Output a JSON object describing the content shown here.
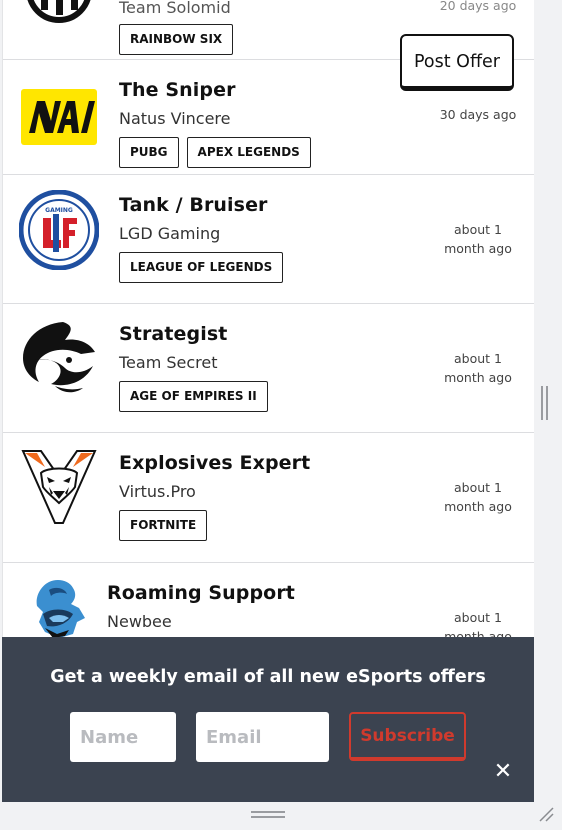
{
  "listings": [
    {
      "title": "",
      "team": "Team Solomid",
      "tags": [
        "RAINBOW SIX"
      ],
      "posted": "",
      "logo": "tsm-logo"
    },
    {
      "title": "The Sniper",
      "team": "Natus Vincere",
      "tags": [
        "PUBG",
        "APEX LEGENDS"
      ],
      "posted": "30 days ago",
      "logo": "navi-logo"
    },
    {
      "title": "Tank / Bruiser",
      "team": "LGD Gaming",
      "tags": [
        "LEAGUE OF LEGENDS"
      ],
      "posted": "about 1 month ago",
      "logo": "lgd-logo"
    },
    {
      "title": "Strategist",
      "team": "Team Secret",
      "tags": [
        "AGE OF EMPIRES II"
      ],
      "posted": "about 1 month ago",
      "logo": "secret-logo"
    },
    {
      "title": "Explosives Expert",
      "team": "Virtus.Pro",
      "tags": [
        "FORTNITE"
      ],
      "posted": "about 1 month ago",
      "logo": "virtuspro-logo"
    },
    {
      "title": "Roaming Support",
      "team": "Newbee",
      "tags": [],
      "posted": "about 1 month ago",
      "logo": "newbee-logo"
    }
  ],
  "post_offer": {
    "label": "Post Offer"
  },
  "newsletter": {
    "heading": "Get a weekly email of all new eSports offers",
    "name_placeholder": "Name",
    "email_placeholder": "Email",
    "subscribe_label": "Subscribe",
    "close_glyph": "✕"
  },
  "colors": {
    "panel_bg": "#3b4350",
    "subscribe_accent": "#d03a2d",
    "navi_yellow": "#ffe600",
    "lgd_blue": "#1f4fa0",
    "lgd_red": "#d4202a",
    "virtus_orange": "#ef6a1e",
    "newbee_blue": "#3b8fd0"
  }
}
